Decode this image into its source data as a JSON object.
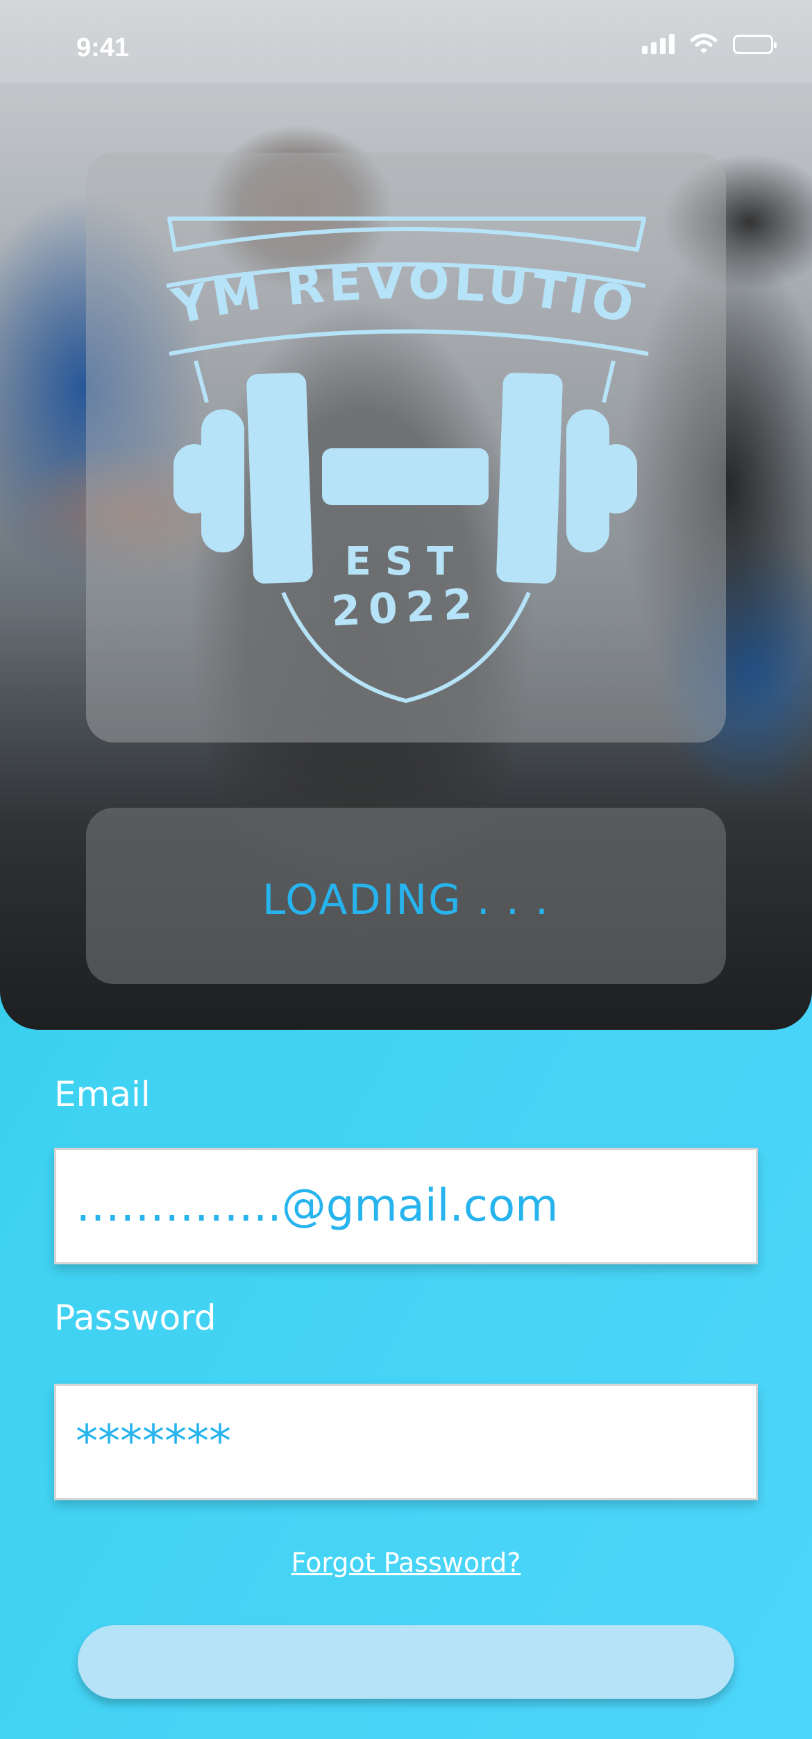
{
  "status_bar": {
    "time": "9:41",
    "icons": [
      "signal-icon",
      "wifi-icon",
      "battery-icon"
    ]
  },
  "hero": {
    "background_image": "gym-photo",
    "logo": {
      "brand_name": "GYM REVOLUTION",
      "est_label": "EST",
      "est_year": "2022",
      "color": "#b6e3f8"
    },
    "loading_text": "LOADING . . ."
  },
  "form": {
    "email_label": "Email",
    "email_value": "…………..@gmail.com",
    "password_label": "Password",
    "password_value": "*******",
    "forgot_password_link": "Forgot Password?",
    "submit_label": ""
  },
  "colors": {
    "accent_text": "#27b4ee",
    "background_gradient_start": "#22c3dc",
    "background_gradient_end": "#4dd5fb",
    "button": "#b6e3f8"
  }
}
